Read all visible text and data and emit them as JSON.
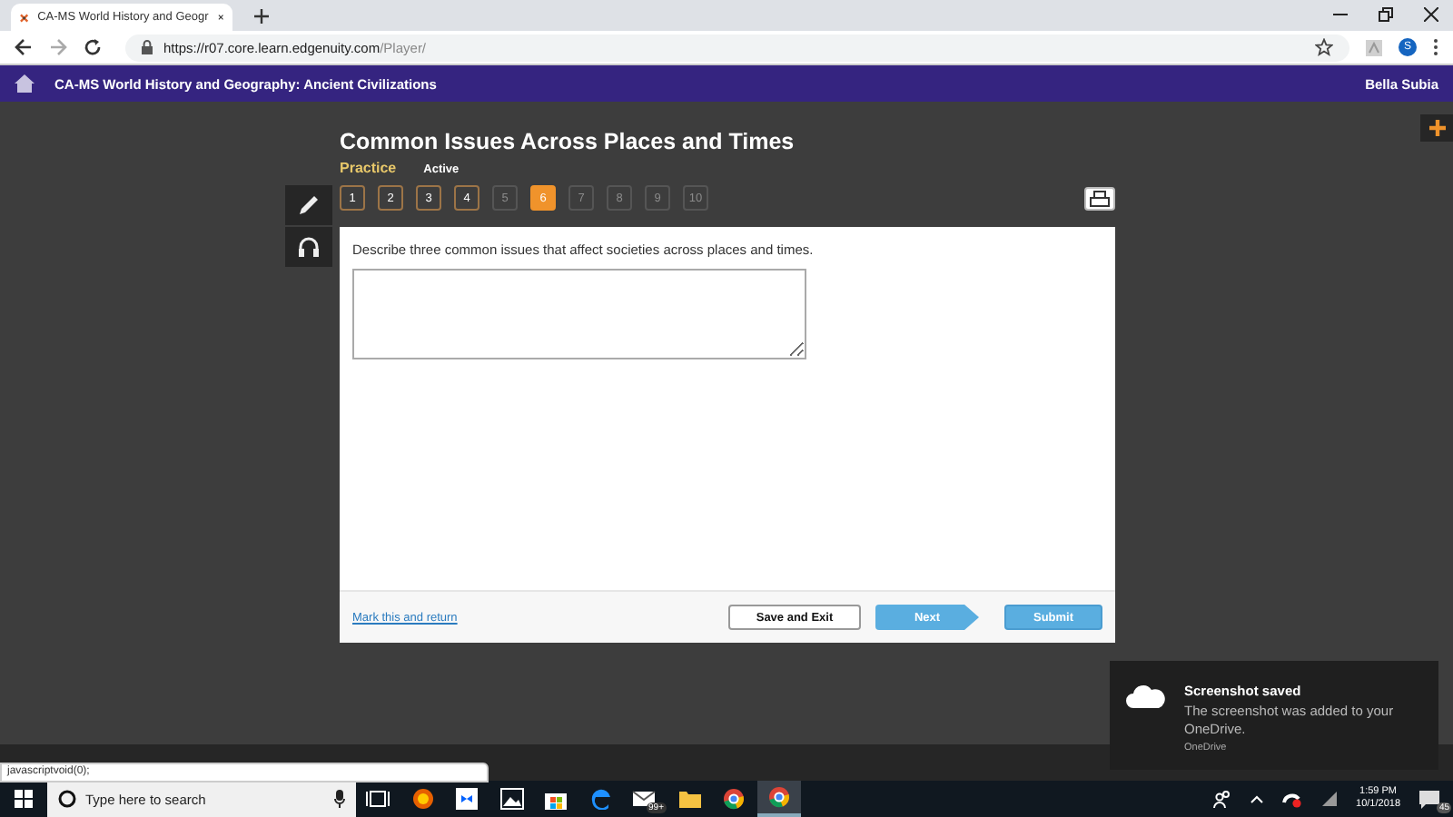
{
  "browser": {
    "tab_title": "CA-MS World History and Geogr",
    "url_host": "https://r07.core.learn.edgenuity.com",
    "url_path": "/Player/",
    "profile_initial": "S"
  },
  "header": {
    "course_title": "CA-MS World History and Geography: Ancient Civilizations",
    "user_name": "Bella Subia"
  },
  "activity": {
    "title": "Common Issues Across Places and Times",
    "type": "Practice",
    "status": "Active"
  },
  "questions": [
    {
      "label": "1",
      "selected": false,
      "disabled": false
    },
    {
      "label": "2",
      "selected": false,
      "disabled": false
    },
    {
      "label": "3",
      "selected": false,
      "disabled": false
    },
    {
      "label": "4",
      "selected": false,
      "disabled": false
    },
    {
      "label": "5",
      "selected": false,
      "disabled": true
    },
    {
      "label": "6",
      "selected": true,
      "disabled": false
    },
    {
      "label": "7",
      "selected": false,
      "disabled": true
    },
    {
      "label": "8",
      "selected": false,
      "disabled": true
    },
    {
      "label": "9",
      "selected": false,
      "disabled": true
    },
    {
      "label": "10",
      "selected": false,
      "disabled": true
    }
  ],
  "prompt": "Describe three common issues that affect societies across places and times.",
  "footer": {
    "link": "Mark this and return",
    "buttons": [
      "Save and Exit",
      "Next",
      "Submit"
    ]
  },
  "status_link": "javascriptvoid(0);",
  "notification": {
    "title": "Screenshot saved",
    "message": "The screenshot was added to your OneDrive.",
    "source": "OneDrive"
  },
  "taskbar": {
    "search_placeholder": "Type here to search",
    "mail_badge": "99+",
    "time": "1:59 PM",
    "date": "10/1/2018",
    "notification_count": "45"
  }
}
